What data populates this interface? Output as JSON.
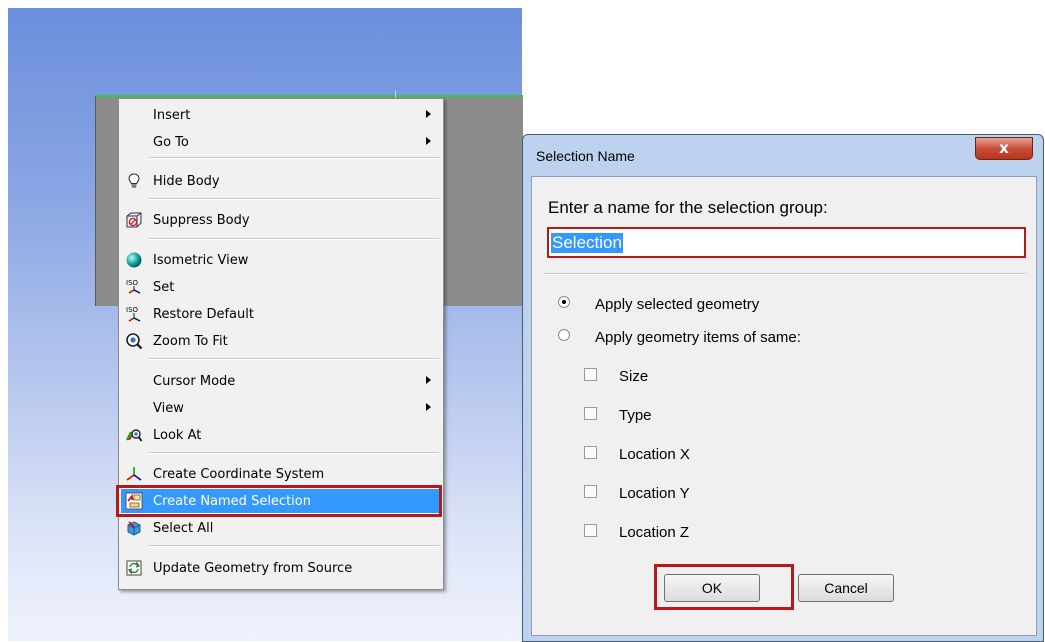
{
  "menu": {
    "items": [
      {
        "label": "Insert",
        "icon": "none",
        "submenu": true
      },
      {
        "label": "Go To",
        "icon": "none",
        "submenu": true
      },
      {
        "label": "Hide Body",
        "icon": "lightbulb-icon"
      },
      {
        "label": "Suppress Body",
        "icon": "suppress-body-icon"
      },
      {
        "label": "Isometric View",
        "icon": "isometric-sphere-icon"
      },
      {
        "label": "Set",
        "icon": "iso-set-icon",
        "icon_text": "ISO"
      },
      {
        "label": "Restore Default",
        "icon": "iso-restore-icon",
        "icon_text": "ISO"
      },
      {
        "label": "Zoom To Fit",
        "icon": "zoom-to-fit-icon"
      },
      {
        "label": "Cursor Mode",
        "icon": "none",
        "submenu": true
      },
      {
        "label": "View",
        "icon": "none",
        "submenu": true
      },
      {
        "label": "Look At",
        "icon": "look-at-icon"
      },
      {
        "label": "Create Coordinate System",
        "icon": "coordinate-system-icon"
      },
      {
        "label": "Create Named Selection",
        "icon": "named-selection-icon",
        "highlighted": true
      },
      {
        "label": "Select All",
        "icon": "select-all-icon"
      },
      {
        "label": "Update Geometry from Source",
        "icon": "update-geometry-icon"
      }
    ]
  },
  "dialog": {
    "title": "Selection Name",
    "close_symbol": "x",
    "prompt": "Enter a name for the selection group:",
    "name_value": "Selection",
    "radio_selected": "Apply selected geometry",
    "radio_same": "Apply geometry items of same:",
    "checkboxes": [
      "Size",
      "Type",
      "Location X",
      "Location Y",
      "Location Z"
    ],
    "ok_label": "OK",
    "cancel_label": "Cancel"
  },
  "colors": {
    "highlight": "#3399ff",
    "callout_red": "#b41a1a",
    "viewport_top": "#6b8fdc",
    "model_gray": "#8c8c8c"
  }
}
